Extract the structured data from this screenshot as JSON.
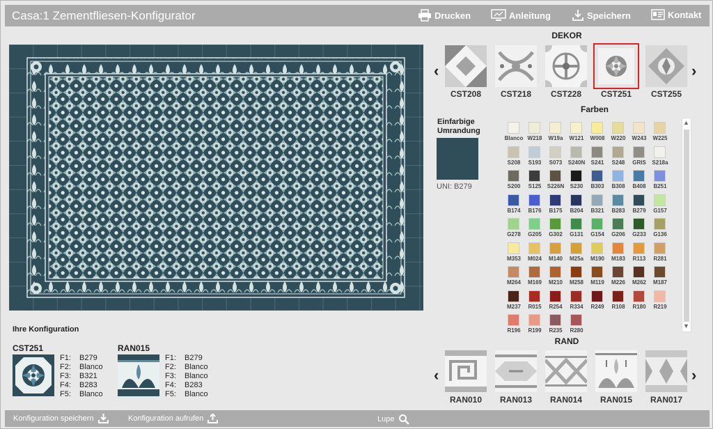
{
  "header": {
    "title": "Casa:1 Zementfliesen-Konfigurator",
    "print_label": "Drucken",
    "guide_label": "Anleitung",
    "save_label": "Speichern",
    "contact_label": "Kontakt"
  },
  "dekor": {
    "title": "DEKOR",
    "tiles": [
      "CST208",
      "CST218",
      "CST228",
      "CST251",
      "CST255"
    ],
    "selected": "CST251"
  },
  "farben": {
    "title": "Farben",
    "border_label_1": "Einfarbige",
    "border_label_2": "Umrandung",
    "uni_label": "UNI: B279",
    "colors": [
      {
        "code": "Blanco",
        "hex": "#f4f3ea"
      },
      {
        "code": "W218",
        "hex": "#f1ecd5"
      },
      {
        "code": "W19a",
        "hex": "#f4efd3"
      },
      {
        "code": "W121",
        "hex": "#f6f0cc"
      },
      {
        "code": "W008",
        "hex": "#f7ec9b"
      },
      {
        "code": "W220",
        "hex": "#e6dc9c"
      },
      {
        "code": "W243",
        "hex": "#f1e4c8"
      },
      {
        "code": "W225",
        "hex": "#e7d3a6"
      },
      {
        "code": "S208",
        "hex": "#c9c4b2"
      },
      {
        "code": "S193",
        "hex": "#c1cdd6"
      },
      {
        "code": "S073",
        "hex": "#d4d0c1"
      },
      {
        "code": "S240N",
        "hex": "#b9b9ae"
      },
      {
        "code": "S241",
        "hex": "#8c8a80"
      },
      {
        "code": "S248",
        "hex": "#b0a890"
      },
      {
        "code": "GRIS",
        "hex": "#8f8d86"
      },
      {
        "code": "S218a",
        "hex": "#f2f1ec"
      },
      {
        "code": "S200",
        "hex": "#6d6a5e"
      },
      {
        "code": "S125",
        "hex": "#3c3c3c"
      },
      {
        "code": "S226N",
        "hex": "#5d5342"
      },
      {
        "code": "S230",
        "hex": "#1a1a1a"
      },
      {
        "code": "B303",
        "hex": "#3f5e8f"
      },
      {
        "code": "B308",
        "hex": "#8fb4e3"
      },
      {
        "code": "B408",
        "hex": "#487ba6"
      },
      {
        "code": "B251",
        "hex": "#7c90df"
      },
      {
        "code": "B174",
        "hex": "#3a5aa3"
      },
      {
        "code": "B176",
        "hex": "#4a5fcf"
      },
      {
        "code": "B175",
        "hex": "#2e3b74"
      },
      {
        "code": "B204",
        "hex": "#2a3560"
      },
      {
        "code": "B321",
        "hex": "#93a9b8"
      },
      {
        "code": "B283",
        "hex": "#5a8ba0"
      },
      {
        "code": "B279",
        "hex": "#2f4e5a"
      },
      {
        "code": "G157",
        "hex": "#c5e6a1"
      },
      {
        "code": "G278",
        "hex": "#9ed48b"
      },
      {
        "code": "G205",
        "hex": "#7ecf89"
      },
      {
        "code": "G302",
        "hex": "#5a9a3c"
      },
      {
        "code": "G131",
        "hex": "#3f8b4b"
      },
      {
        "code": "G154",
        "hex": "#5ab065"
      },
      {
        "code": "G206",
        "hex": "#4a7d56"
      },
      {
        "code": "G233",
        "hex": "#2f5a2a"
      },
      {
        "code": "G136",
        "hex": "#a3a163"
      },
      {
        "code": "M353",
        "hex": "#f7ea9d"
      },
      {
        "code": "M024",
        "hex": "#e5c264"
      },
      {
        "code": "M140",
        "hex": "#d6a03f"
      },
      {
        "code": "M25a",
        "hex": "#d5a035"
      },
      {
        "code": "M190",
        "hex": "#e0cc5d"
      },
      {
        "code": "M183",
        "hex": "#e4873c"
      },
      {
        "code": "R113",
        "hex": "#e39a3c"
      },
      {
        "code": "R281",
        "hex": "#d1a067"
      },
      {
        "code": "M264",
        "hex": "#c58a63"
      },
      {
        "code": "M169",
        "hex": "#ad6b3e"
      },
      {
        "code": "M210",
        "hex": "#b0622e"
      },
      {
        "code": "M258",
        "hex": "#8b3d12"
      },
      {
        "code": "M119",
        "hex": "#8a4b1d"
      },
      {
        "code": "M226",
        "hex": "#6b4632"
      },
      {
        "code": "M262",
        "hex": "#5a3222"
      },
      {
        "code": "M187",
        "hex": "#6b4a2d"
      },
      {
        "code": "M237",
        "hex": "#4a2418"
      },
      {
        "code": "R015",
        "hex": "#aa2c20"
      },
      {
        "code": "R254",
        "hex": "#8a1d17"
      },
      {
        "code": "R334",
        "hex": "#9a2e26"
      },
      {
        "code": "R249",
        "hex": "#6d1a18"
      },
      {
        "code": "R108",
        "hex": "#7a2219"
      },
      {
        "code": "R180",
        "hex": "#b04a3c"
      },
      {
        "code": "R219",
        "hex": "#f0b9a5"
      },
      {
        "code": "R196",
        "hex": "#de7b6b"
      },
      {
        "code": "R199",
        "hex": "#e99a86"
      },
      {
        "code": "R235",
        "hex": "#8d5a63"
      },
      {
        "code": "R280",
        "hex": "#a45659"
      }
    ]
  },
  "rand": {
    "title": "RAND",
    "tiles": [
      "RAN010",
      "RAN013",
      "RAN014",
      "RAN015",
      "RAN017"
    ],
    "selected": "RAN015"
  },
  "config": {
    "title": "Ihre Konfiguration",
    "blocks": [
      {
        "code": "CST251",
        "fields": [
          [
            "F1:",
            "B279"
          ],
          [
            "F2:",
            "Blanco"
          ],
          [
            "F3:",
            "B321"
          ],
          [
            "F4:",
            "B283"
          ],
          [
            "F5:",
            "Blanco"
          ]
        ]
      },
      {
        "code": "RAN015",
        "fields": [
          [
            "F1:",
            "B279"
          ],
          [
            "F2:",
            "Blanco"
          ],
          [
            "F3:",
            "Blanco"
          ],
          [
            "F4:",
            "B283"
          ],
          [
            "F5:",
            "Blanco"
          ]
        ]
      }
    ]
  },
  "footer": {
    "save_config": "Konfiguration speichern",
    "load_config": "Konfiguration aufrufen",
    "magnifier": "Lupe"
  },
  "colors": {
    "accent_tile": "#2f4e5a",
    "tile_light": "#7fa6aa",
    "selected_outline": "#dd2222",
    "bar_gray": "#ababab"
  }
}
